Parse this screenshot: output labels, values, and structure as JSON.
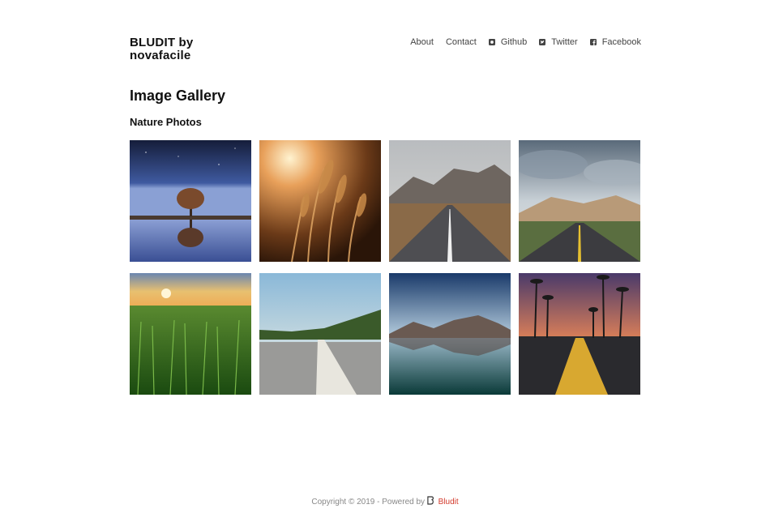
{
  "site": {
    "title": "BLUDIT by novafacile"
  },
  "nav": {
    "about": "About",
    "contact": "Contact",
    "github": "Github",
    "twitter": "Twitter",
    "facebook": "Facebook",
    "icons": [
      "github-icon",
      "twitter-icon",
      "facebook-icon"
    ]
  },
  "page": {
    "title": "Image Gallery",
    "album_title": "Nature Photos"
  },
  "gallery": {
    "images": [
      "tree reflection at night",
      "golden grass at sunset",
      "mountain road",
      "cloudy road with yellow line",
      "green grass at sunrise",
      "road marking close-up",
      "mountain lake reflection",
      "palm trees road at dusk"
    ]
  },
  "footer": {
    "copyright": "Copyright © 2019 - Powered by",
    "link": "Bludit",
    "link_color": "#d33a2c"
  }
}
